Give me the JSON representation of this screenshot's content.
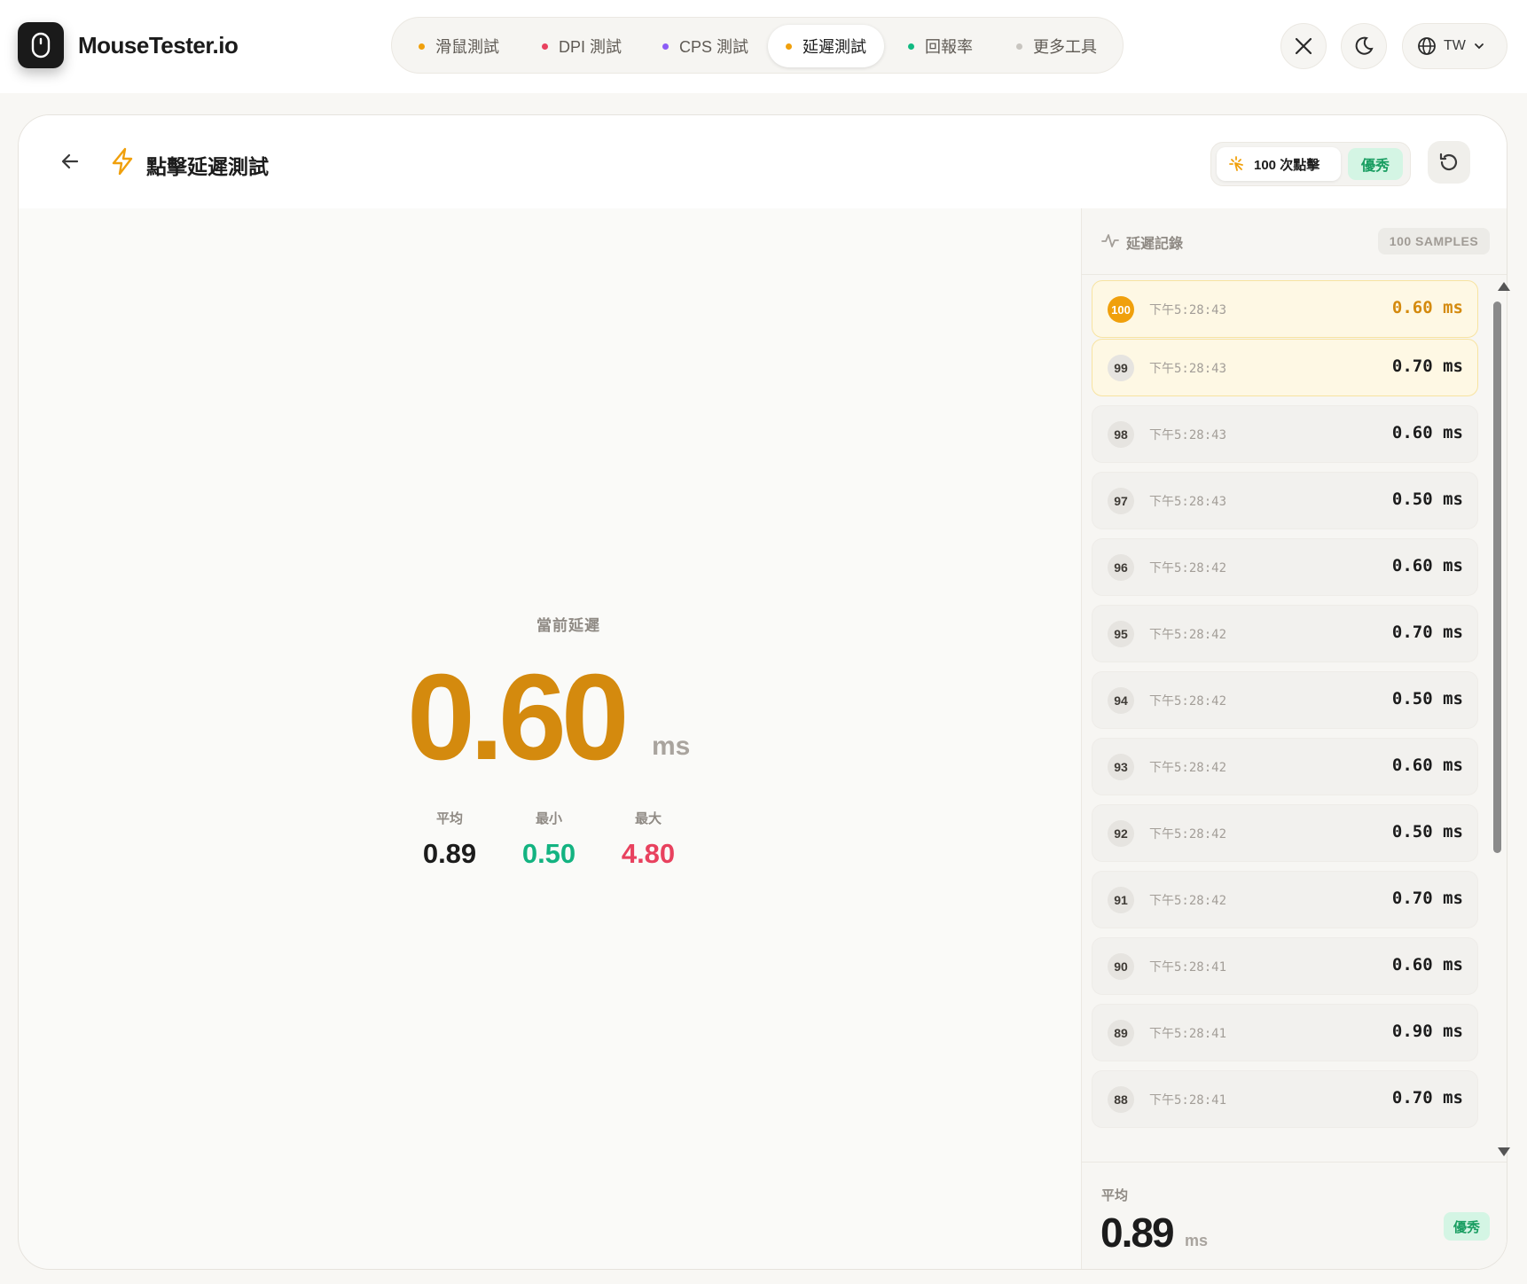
{
  "brand": "MouseTester.io",
  "nav": [
    {
      "label": "滑鼠測試",
      "color": "#f0a00c",
      "active": false
    },
    {
      "label": "DPI 測試",
      "color": "#e8415e",
      "active": false
    },
    {
      "label": "CPS 測試",
      "color": "#8b5cf6",
      "active": false
    },
    {
      "label": "延遲測試",
      "color": "#f0a00c",
      "active": true
    },
    {
      "label": "回報率",
      "color": "#10b981",
      "active": false
    },
    {
      "label": "更多工具",
      "color": "#c8c5c0",
      "active": false
    }
  ],
  "lang": "TW",
  "header": {
    "title": "點擊延遲測試",
    "clicks": "100 次點擊",
    "rating": "優秀"
  },
  "current": {
    "label": "當前延遲",
    "value": "0.60",
    "unit": "ms"
  },
  "stats": {
    "avg_label": "平均",
    "avg": "0.89",
    "min_label": "最小",
    "min": "0.50",
    "max_label": "最大",
    "max": "4.80"
  },
  "panel": {
    "title": "延遲記錄",
    "samples": "100 SAMPLES",
    "rows": [
      {
        "n": "100",
        "time": "下午5:28:43",
        "ms": "0.60 ms"
      },
      {
        "n": "99",
        "time": "下午5:28:43",
        "ms": "0.70 ms"
      },
      {
        "n": "98",
        "time": "下午5:28:43",
        "ms": "0.60 ms"
      },
      {
        "n": "97",
        "time": "下午5:28:43",
        "ms": "0.50 ms"
      },
      {
        "n": "96",
        "time": "下午5:28:42",
        "ms": "0.60 ms"
      },
      {
        "n": "95",
        "time": "下午5:28:42",
        "ms": "0.70 ms"
      },
      {
        "n": "94",
        "time": "下午5:28:42",
        "ms": "0.50 ms"
      },
      {
        "n": "93",
        "time": "下午5:28:42",
        "ms": "0.60 ms"
      },
      {
        "n": "92",
        "time": "下午5:28:42",
        "ms": "0.50 ms"
      },
      {
        "n": "91",
        "time": "下午5:28:42",
        "ms": "0.70 ms"
      },
      {
        "n": "90",
        "time": "下午5:28:41",
        "ms": "0.60 ms"
      },
      {
        "n": "89",
        "time": "下午5:28:41",
        "ms": "0.90 ms"
      },
      {
        "n": "88",
        "time": "下午5:28:41",
        "ms": "0.70 ms"
      }
    ],
    "footer_label": "平均",
    "footer_value": "0.89",
    "footer_unit": "ms",
    "footer_rating": "優秀"
  }
}
